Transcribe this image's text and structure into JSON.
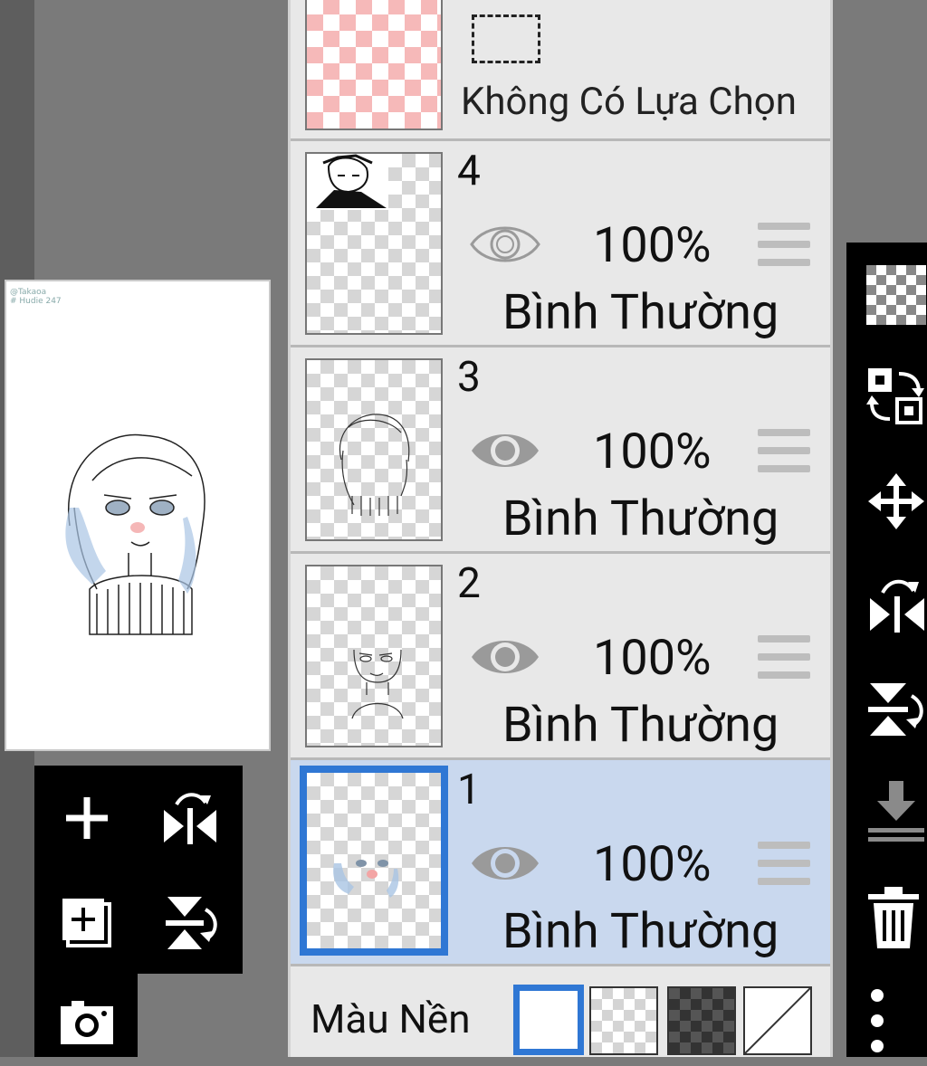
{
  "selection": {
    "label": "Không Có Lựa Chọn"
  },
  "layers": [
    {
      "number": "4",
      "opacity": "100%",
      "blend": "Bình Thường",
      "visible": false,
      "active": false
    },
    {
      "number": "3",
      "opacity": "100%",
      "blend": "Bình Thường",
      "visible": true,
      "active": false
    },
    {
      "number": "2",
      "opacity": "100%",
      "blend": "Bình Thường",
      "visible": true,
      "active": false
    },
    {
      "number": "1",
      "opacity": "100%",
      "blend": "Bình Thường",
      "visible": true,
      "active": true
    }
  ],
  "background": {
    "label": "Màu Nền",
    "options": [
      "white",
      "transparent-light",
      "transparent-dark",
      "none"
    ],
    "selected": "white"
  },
  "canvas": {
    "watermark_line1": "@Takaoa",
    "watermark_line2": "# Hudie 247"
  },
  "colors": {
    "accent": "#2f77d4",
    "active_row": "#c9d8ee",
    "panel_bg": "#e8e8e8",
    "toolbar_bg": "#000000"
  },
  "left_palette": [
    "add-layer-icon",
    "flip-horizontal-icon",
    "duplicate-layer-icon",
    "flip-vertical-icon",
    "camera-icon"
  ],
  "right_toolbar": [
    "transparency-icon",
    "swap-layer-icon",
    "move-icon",
    "flip-horizontal-icon",
    "flip-vertical-icon",
    "merge-down-icon",
    "trash-icon",
    "more-vert-icon"
  ]
}
